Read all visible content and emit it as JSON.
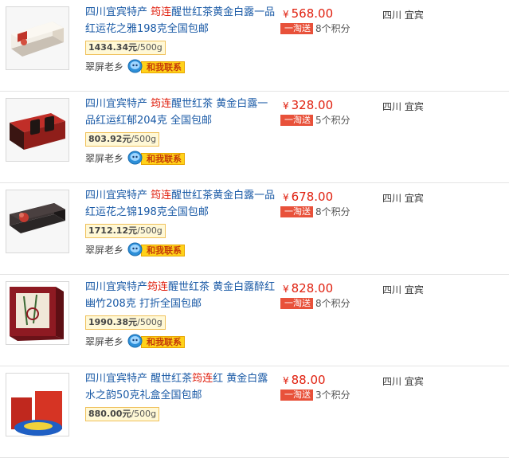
{
  "items": [
    {
      "title_pre": "四川宜宾特产 ",
      "title_hl": "筠连",
      "title_post": "醒世红茶黄金白露一品红运花之雅198克全国包邮",
      "unit_price": "1434.34元",
      "unit_suffix": "/500g",
      "shop": "翠屏老乡",
      "contact_label": "和我联系",
      "currency": "¥",
      "price": "568.00",
      "badge": "一淘送",
      "points": "8个积分",
      "location": "四川 宜宾",
      "thumb_icon": "tea-gift-box-white"
    },
    {
      "title_pre": "四川宜宾特产 ",
      "title_hl": "筠连",
      "title_post": "醒世红茶 黄金白露一品红运红郁204克 全国包邮",
      "unit_price": "803.92元",
      "unit_suffix": "/500g",
      "shop": "翠屏老乡",
      "contact_label": "和我联系",
      "currency": "¥",
      "price": "328.00",
      "badge": "一淘送",
      "points": "5个积分",
      "location": "四川 宜宾",
      "thumb_icon": "tea-gift-box-red"
    },
    {
      "title_pre": "四川宜宾特产 ",
      "title_hl": "筠连",
      "title_post": "醒世红茶黄金白露一品红运花之锦198克全国包邮",
      "unit_price": "1712.12元",
      "unit_suffix": "/500g",
      "shop": "翠屏老乡",
      "contact_label": "和我联系",
      "currency": "¥",
      "price": "678.00",
      "badge": "一淘送",
      "points": "8个积分",
      "location": "四川 宜宾",
      "thumb_icon": "tea-gift-box-dark"
    },
    {
      "title_pre": "四川宜宾特产",
      "title_hl": "筠连",
      "title_post": "醒世红茶 黄金白露醉红幽竹208克 打折全国包邮",
      "unit_price": "1990.38元",
      "unit_suffix": "/500g",
      "shop": "翠屏老乡",
      "contact_label": "和我联系",
      "currency": "¥",
      "price": "828.00",
      "badge": "一淘送",
      "points": "8个积分",
      "location": "四川 宜宾",
      "thumb_icon": "tea-gift-box-bamboo"
    },
    {
      "title_pre": "四川宜宾特产 醒世红茶",
      "title_hl": "筠连",
      "title_post": "红 黄金白露 水之韵50克礼盒全国包邮",
      "unit_price": "880.00元",
      "unit_suffix": "/500g",
      "shop": "",
      "contact_label": "",
      "currency": "¥",
      "price": "88.00",
      "badge": "一淘送",
      "points": "3个积分",
      "location": "四川 宜宾",
      "thumb_icon": "tea-gift-box-blue"
    }
  ],
  "colors": {
    "link": "#1a5aa6",
    "highlight": "#e0200f",
    "price": "#e0200f",
    "badge_bg": "#e8513a",
    "unit_border": "#f0c15b"
  }
}
